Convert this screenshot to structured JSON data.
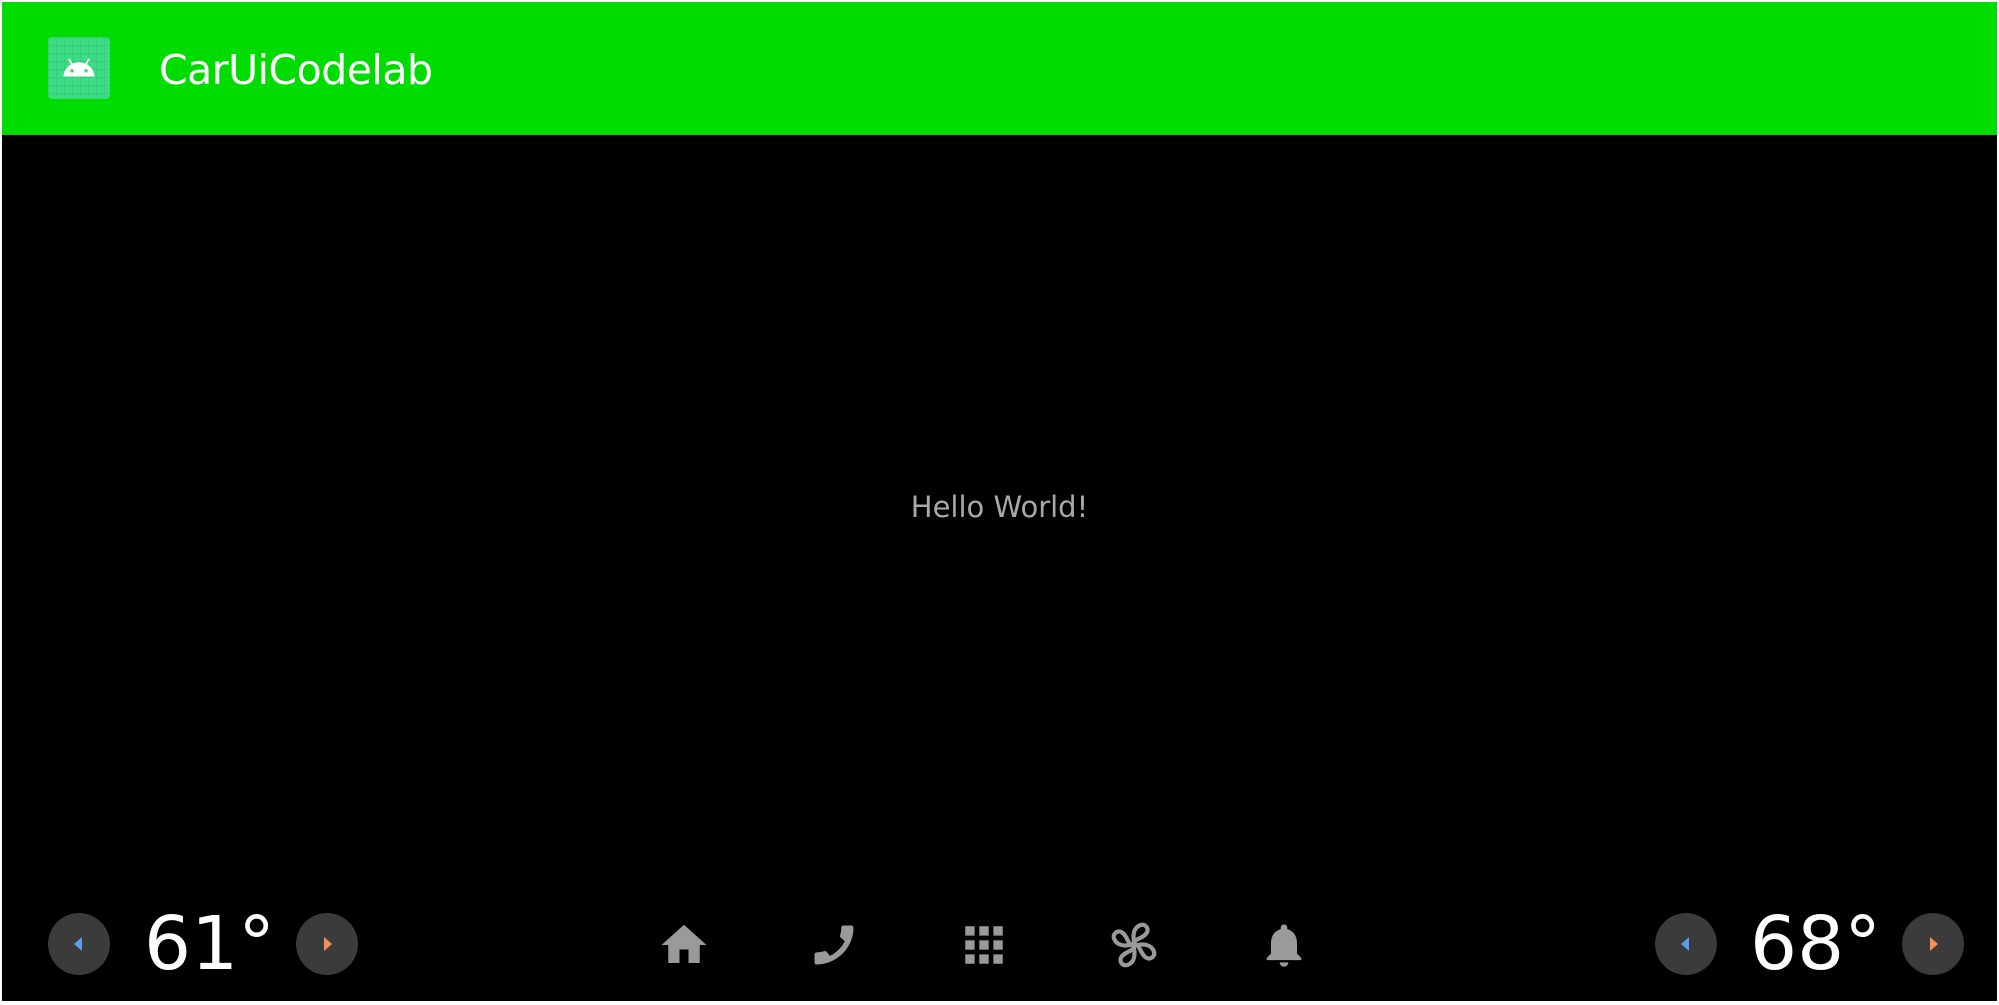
{
  "app_bar": {
    "title": "CarUiCodelab",
    "icon": "android-icon",
    "color": "#00dc00"
  },
  "content": {
    "text": "Hello World!"
  },
  "system_bar": {
    "left_temp": {
      "value": "61°",
      "decrease_icon": "chevron-left-icon",
      "increase_icon": "chevron-right-icon"
    },
    "right_temp": {
      "value": "68°",
      "decrease_icon": "chevron-left-icon",
      "increase_icon": "chevron-right-icon"
    },
    "nav_icons": [
      "home-icon",
      "phone-icon",
      "apps-grid-icon",
      "fan-icon",
      "bell-icon"
    ],
    "decrease_color": "#5b9bf0",
    "increase_color": "#f39060",
    "icon_color": "#9a9a9a"
  }
}
